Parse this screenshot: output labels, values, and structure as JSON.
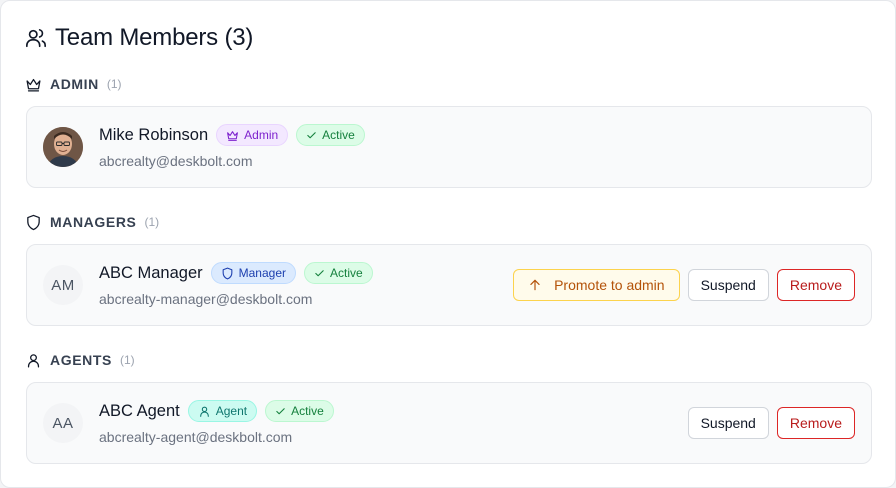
{
  "header": {
    "title": "Team Members (3)",
    "icon": "users-icon"
  },
  "sections": [
    {
      "key": "admin",
      "title": "ADMIN",
      "count": "(1)",
      "icon": "crown-icon",
      "members": [
        {
          "initials": "",
          "avatar": "photo",
          "name": "Mike Robinson",
          "email": "abcrealty@deskbolt.com",
          "role_badge": "Admin",
          "status_badge": "Active"
        }
      ]
    },
    {
      "key": "managers",
      "title": "MANAGERS",
      "count": "(1)",
      "icon": "shield-icon",
      "members": [
        {
          "initials": "AM",
          "name": "ABC Manager",
          "email": "abcrealty-manager@deskbolt.com",
          "role_badge": "Manager",
          "status_badge": "Active",
          "actions": {
            "promote": "Promote to admin",
            "suspend": "Suspend",
            "remove": "Remove"
          }
        }
      ]
    },
    {
      "key": "agents",
      "title": "AGENTS",
      "count": "(1)",
      "icon": "user-icon",
      "members": [
        {
          "initials": "AA",
          "name": "ABC Agent",
          "email": "abcrealty-agent@deskbolt.com",
          "role_badge": "Agent",
          "status_badge": "Active",
          "actions": {
            "suspend": "Suspend",
            "remove": "Remove"
          }
        }
      ]
    }
  ],
  "colors": {
    "admin_badge": "#7e22ce",
    "manager_badge": "#1e40af",
    "agent_badge": "#0f766e",
    "active_badge": "#15803d",
    "promote": "#b45309",
    "remove": "#b91c1c"
  }
}
